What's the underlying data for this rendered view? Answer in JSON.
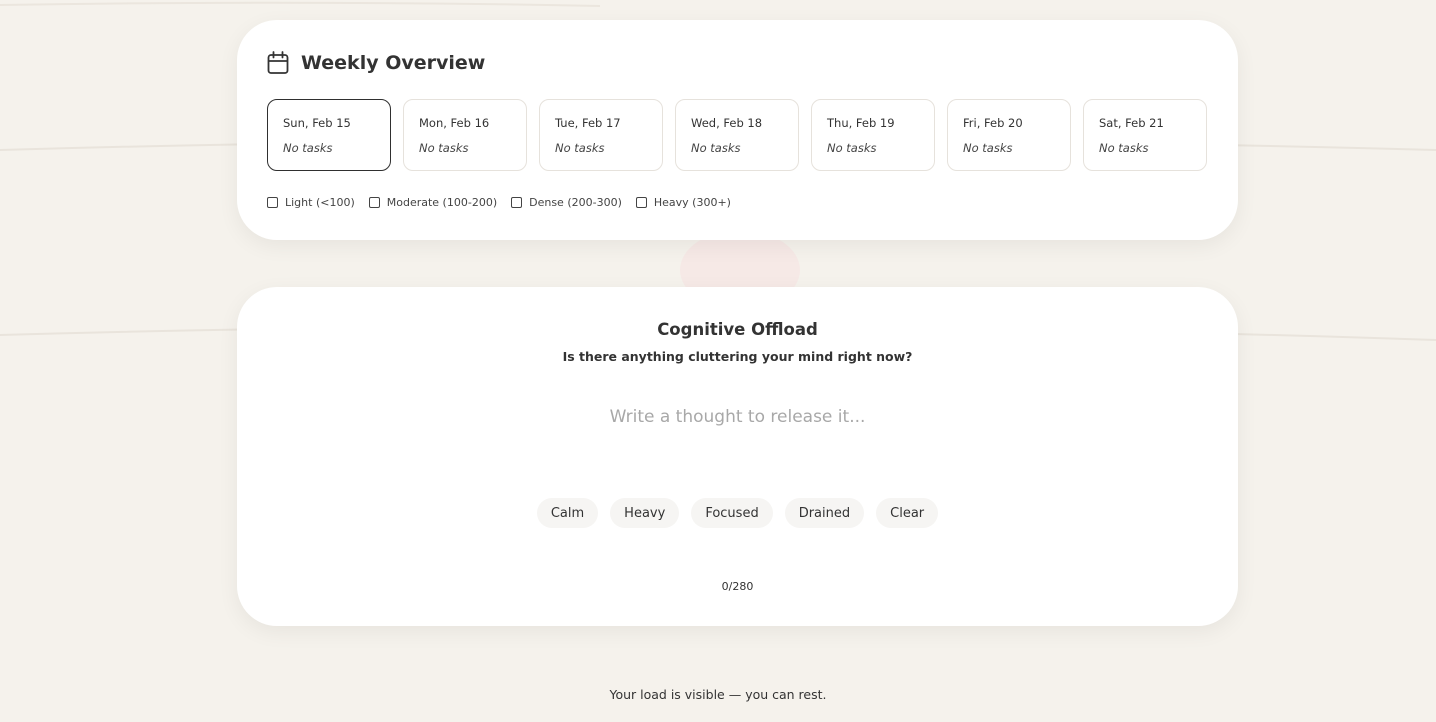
{
  "weekly_overview": {
    "title": "Weekly Overview",
    "icon": "calendar-icon",
    "days": [
      {
        "label": "Sun, Feb 15",
        "tasks": "No tasks",
        "selected": true
      },
      {
        "label": "Mon, Feb 16",
        "tasks": "No tasks",
        "selected": false
      },
      {
        "label": "Tue, Feb 17",
        "tasks": "No tasks",
        "selected": false
      },
      {
        "label": "Wed, Feb 18",
        "tasks": "No tasks",
        "selected": false
      },
      {
        "label": "Thu, Feb 19",
        "tasks": "No tasks",
        "selected": false
      },
      {
        "label": "Fri, Feb 20",
        "tasks": "No tasks",
        "selected": false
      },
      {
        "label": "Sat, Feb 21",
        "tasks": "No tasks",
        "selected": false
      }
    ],
    "legend": [
      {
        "label": "Light (<100)",
        "checked": false
      },
      {
        "label": "Moderate (100-200)",
        "checked": false
      },
      {
        "label": "Dense (200-300)",
        "checked": false
      },
      {
        "label": "Heavy (300+)",
        "checked": false
      }
    ]
  },
  "cognitive_offload": {
    "title": "Cognitive Offload",
    "subtitle": "Is there anything cluttering your mind right now?",
    "input_value": "",
    "input_placeholder": "Write a thought to release it...",
    "moods": [
      "Calm",
      "Heavy",
      "Focused",
      "Drained",
      "Clear"
    ],
    "counter": "0/280"
  },
  "footer": {
    "message": "Your load is visible — you can rest."
  },
  "colors": {
    "background": "#f5f2ec",
    "card": "#ffffff",
    "text": "#2f2f2f",
    "chip": "#f6f5f3",
    "selected_border": "#2f2f2f"
  }
}
